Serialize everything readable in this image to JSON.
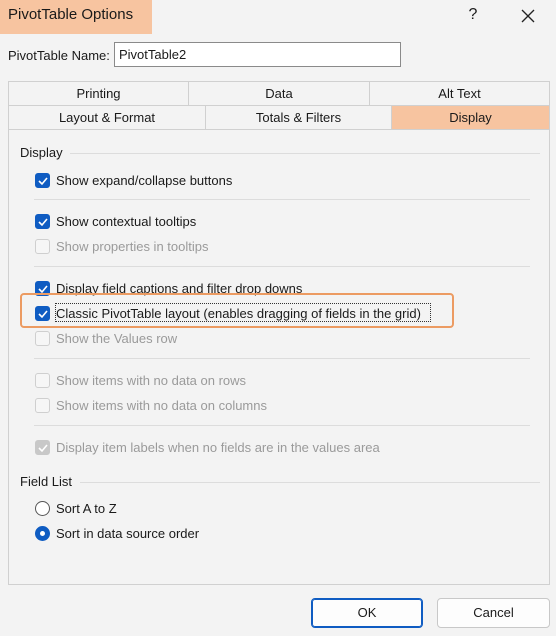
{
  "window": {
    "title": "PivotTable Options",
    "help_label": "?"
  },
  "name_field": {
    "label": "PivotTable Name:",
    "value": "PivotTable2"
  },
  "tabs_row1": [
    {
      "label": "Printing"
    },
    {
      "label": "Data"
    },
    {
      "label": "Alt Text"
    }
  ],
  "tabs_row2": [
    {
      "label": "Layout & Format"
    },
    {
      "label": "Totals & Filters"
    },
    {
      "label": "Display",
      "active": true
    }
  ],
  "display_group": {
    "title": "Display",
    "options": [
      {
        "label": "Show expand/collapse buttons",
        "checked": true,
        "enabled": true
      },
      {
        "label": "Show contextual tooltips",
        "checked": true,
        "enabled": true
      },
      {
        "label": "Show properties in tooltips",
        "checked": false,
        "enabled": false
      },
      {
        "label": "Display field captions and filter drop downs",
        "checked": true,
        "enabled": true
      },
      {
        "label": "Classic PivotTable layout (enables dragging of fields in the grid)",
        "checked": true,
        "enabled": true
      },
      {
        "label": "Show the Values row",
        "checked": false,
        "enabled": false
      },
      {
        "label": "Show items with no data on rows",
        "checked": false,
        "enabled": false
      },
      {
        "label": "Show items with no data on columns",
        "checked": false,
        "enabled": false
      },
      {
        "label": "Display item labels when no fields are in the values area",
        "checked": true,
        "enabled": false
      }
    ]
  },
  "field_list_group": {
    "title": "Field List",
    "options": [
      {
        "label": "Sort A to Z",
        "selected": false
      },
      {
        "label": "Sort in data source order",
        "selected": true
      }
    ]
  },
  "buttons": {
    "ok": "OK",
    "cancel": "Cancel"
  },
  "colors": {
    "highlight": "#f7c4a0",
    "outline": "#ec9b62",
    "accent": "#0f5cc2"
  }
}
